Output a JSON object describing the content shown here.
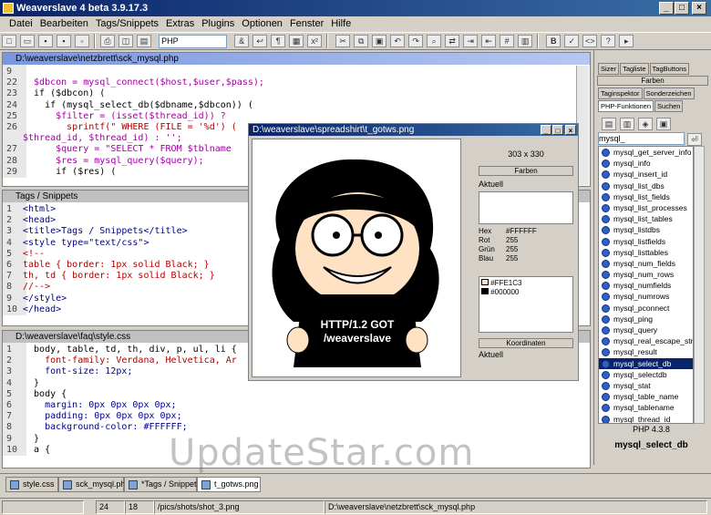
{
  "app": {
    "title": "Weaverslave 4 beta 3.9.17.3"
  },
  "menu": [
    "Datei",
    "Bearbeiten",
    "Tags/Snippets",
    "Extras",
    "Plugins",
    "Optionen",
    "Fenster",
    "Hilfe"
  ],
  "toolbar": {
    "language": "PHP",
    "zoom": "&"
  },
  "editor1": {
    "title": "D:\\weaverslave\\netzbrett\\sck_mysql.php",
    "lines": [
      {
        "n": "9",
        "t": "",
        "c": ""
      },
      {
        "n": "22",
        "t": "  $dbcon = mysql_connect($host,$user,$pass);",
        "c": "var"
      },
      {
        "n": "23",
        "t": "  if ($dbcon) (",
        "c": "kw"
      },
      {
        "n": "24",
        "t": "    if (mysql_select_db($dbname,$dbcon)) (",
        "c": "kw"
      },
      {
        "n": "25",
        "t": "      $filter = (isset($thread_id)) ?",
        "c": "var"
      },
      {
        "n": "26",
        "t": "        sprintf(\" WHERE (FILE = '%d') (",
        "c": "str"
      },
      {
        "n": "",
        "t": "$thread_id, $thread_id) : '';",
        "c": "var"
      },
      {
        "n": "27",
        "t": "      $query = \"SELECT * FROM $tblname",
        "c": "var"
      },
      {
        "n": "28",
        "t": "      $res = mysql_query($query);",
        "c": "var"
      },
      {
        "n": "29",
        "t": "      if ($res) (",
        "c": "kw"
      }
    ]
  },
  "editor2": {
    "title": "Tags / Snippets",
    "lines": [
      {
        "n": "1",
        "t": "<html>",
        "c": "tag"
      },
      {
        "n": "2",
        "t": "<head>",
        "c": "tag"
      },
      {
        "n": "3",
        "t": "<title>Tags / Snippets</title>",
        "c": "tag"
      },
      {
        "n": "4",
        "t": "<style type=\"text/css\">",
        "c": "tag"
      },
      {
        "n": "5",
        "t": "<!--",
        "c": "str"
      },
      {
        "n": "6",
        "t": "table { border: 1px solid Black; }",
        "c": "str"
      },
      {
        "n": "7",
        "t": "th, td { border: 1px solid Black; }",
        "c": "str"
      },
      {
        "n": "8",
        "t": "//-->",
        "c": "str"
      },
      {
        "n": "9",
        "t": "</style>",
        "c": "tag"
      },
      {
        "n": "10",
        "t": "</head>",
        "c": "tag"
      }
    ]
  },
  "editor3": {
    "title": "D:\\weaverslave\\faq\\style.css",
    "lines": [
      {
        "n": "1",
        "t": "  body, table, td, th, div, p, ul, li {",
        "c": "kw"
      },
      {
        "n": "2",
        "t": "    font-family: Verdana, Helvetica, Ar",
        "c": "str"
      },
      {
        "n": "3",
        "t": "    font-size: 12px;",
        "c": "tag"
      },
      {
        "n": "4",
        "t": "  }",
        "c": "kw"
      },
      {
        "n": "5",
        "t": "  body {",
        "c": "kw"
      },
      {
        "n": "6",
        "t": "    margin: 0px 0px 0px 0px;",
        "c": "tag"
      },
      {
        "n": "7",
        "t": "    padding: 0px 0px 0px 0px;",
        "c": "tag"
      },
      {
        "n": "8",
        "t": "    background-color: #FFFFFF;",
        "c": "tag"
      },
      {
        "n": "9",
        "t": "  }",
        "c": "kw"
      },
      {
        "n": "10",
        "t": "  a {",
        "c": "kw"
      }
    ]
  },
  "image_window": {
    "title": "D:\\weaverslave\\spreadshirt\\t_gotws.png",
    "shirt_line1": "HTTP/1.2 GOT",
    "shirt_line2": "/weaverslave",
    "size": "303 x 330",
    "farben": "Farben",
    "aktuell": "Aktuell",
    "hex_label": "Hex",
    "hex_val": "#FFFFFF",
    "rot_label": "Rot",
    "rot_val": "255",
    "gruen_label": "Grün",
    "gruen_val": "255",
    "blau_label": "Blau",
    "blau_val": "255",
    "color1": "#FFE1C3",
    "color2": "#000000",
    "koordinaten": "Koordinaten",
    "aktuell2": "Aktuell"
  },
  "right_panel": {
    "tabs1": [
      "Sizer",
      "Tagliste",
      "TagButtons"
    ],
    "tab_farben": "Farben",
    "tabs2": [
      "Taginspektor",
      "Sonderzeichen"
    ],
    "tabs3": [
      "PHP-Funktionen",
      "Suchen"
    ],
    "search": "mysql_",
    "functions": [
      "mysql_get_server_info",
      "mysql_info",
      "mysql_insert_id",
      "mysql_list_dbs",
      "mysql_list_fields",
      "mysql_list_processes",
      "mysql_list_tables",
      "mysql_listdbs",
      "mysql_listfields",
      "mysql_listtables",
      "mysql_num_fields",
      "mysql_num_rows",
      "mysql_numfields",
      "mysql_numrows",
      "mysql_pconnect",
      "mysql_ping",
      "mysql_query",
      "mysql_real_escape_strin",
      "mysql_result",
      "mysql_select_db",
      "mysql_selectdb",
      "mysql_stat",
      "mysql_table_name",
      "mysql_tablename",
      "mysql_thread_id"
    ],
    "selected": "mysql_select_db",
    "version": "PHP 4.3.8",
    "footer": "mysql_select_db"
  },
  "bottom_tabs": [
    "style.css",
    "sck_mysql.php",
    "*Tags / Snippets",
    "t_gotws.png"
  ],
  "status": {
    "line": "24",
    "col": "18",
    "path1": "/pics/shots/shot_3.png",
    "path2": "D:\\weaverslave\\netzbrett\\sck_mysql.php"
  },
  "watermark": "UpdateStar.com",
  "colors": {
    "title_bg": "#0a246a",
    "selection": "#0a246a"
  }
}
